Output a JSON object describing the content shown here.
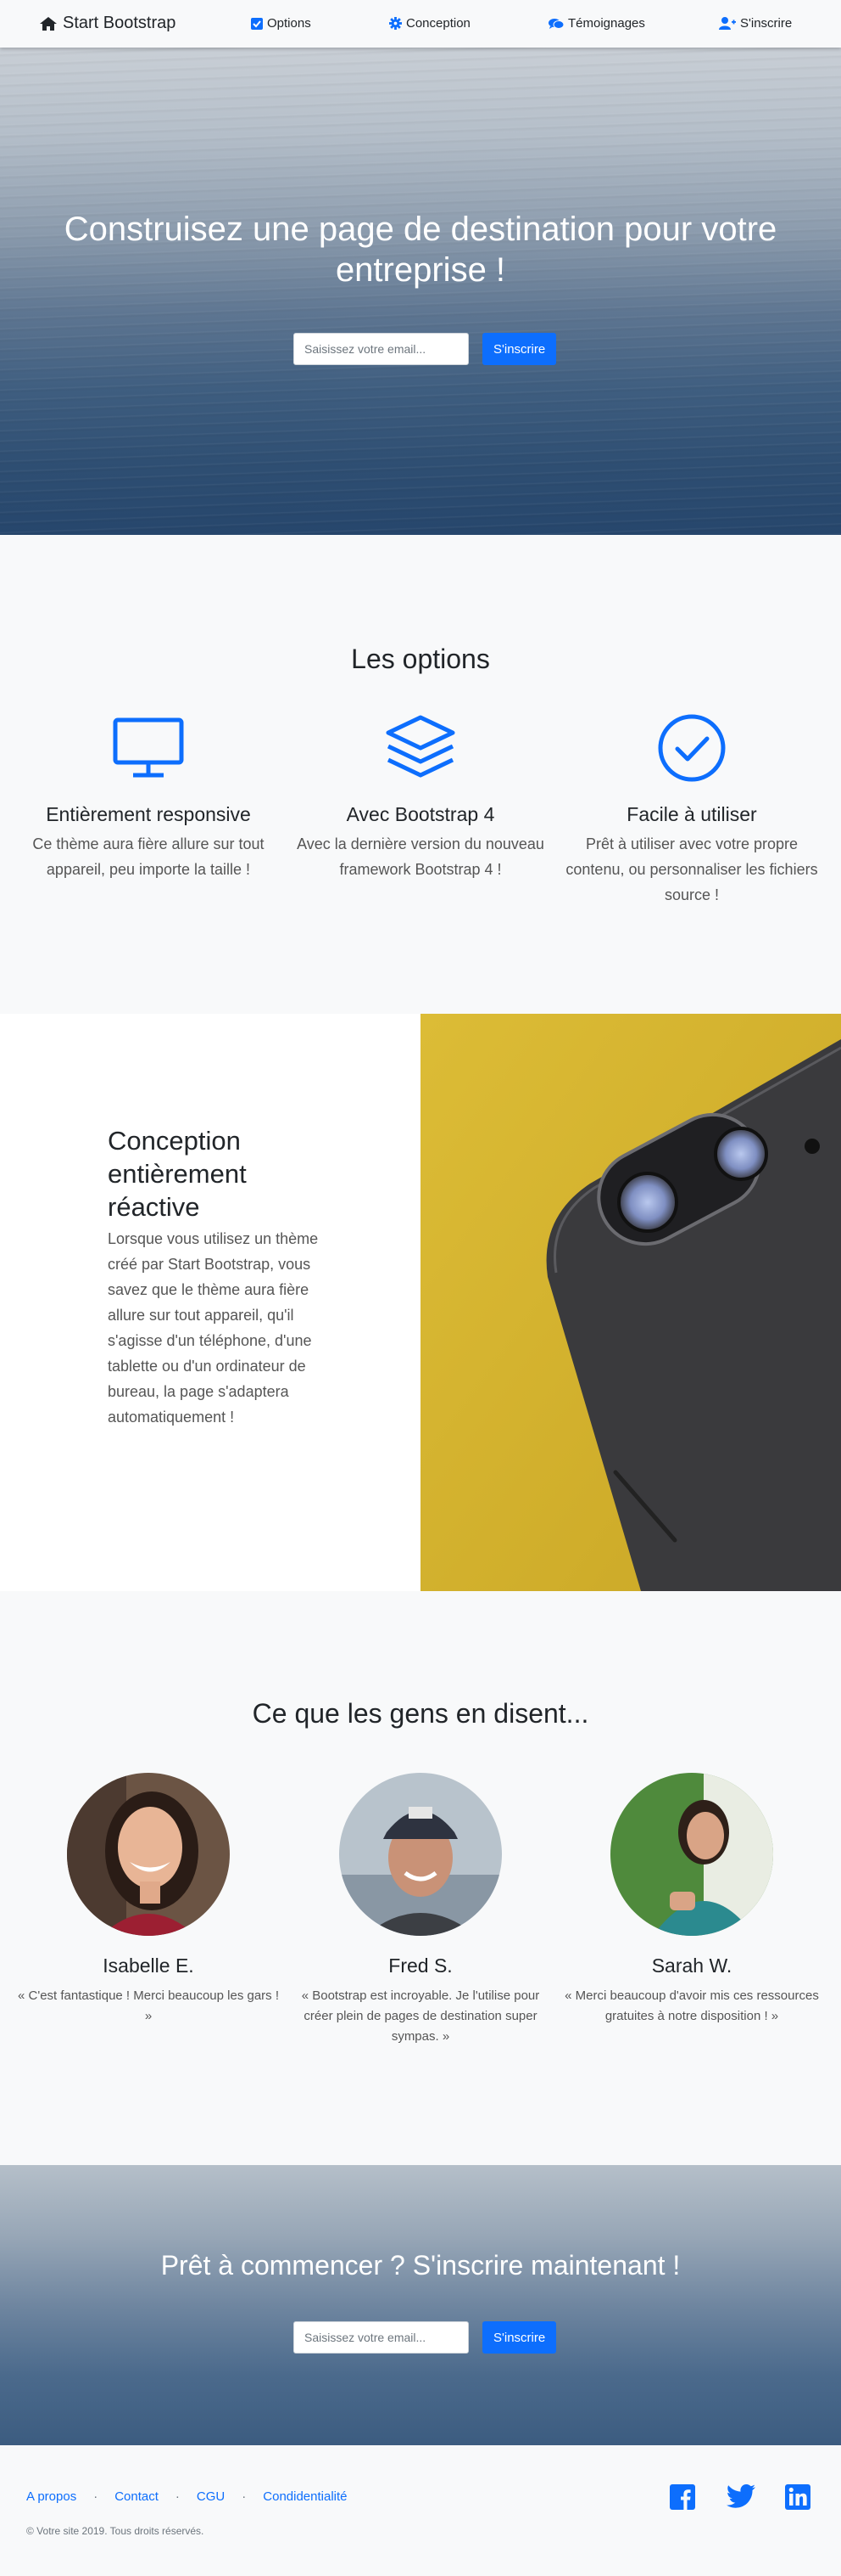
{
  "navbar": {
    "brand": "Start Bootstrap",
    "items": [
      {
        "label": "Options",
        "icon": "check-square-icon"
      },
      {
        "label": "Conception",
        "icon": "gear-icon"
      },
      {
        "label": "Témoignages",
        "icon": "comments-icon"
      },
      {
        "label": "S'inscrire",
        "icon": "user-plus-icon"
      }
    ]
  },
  "hero": {
    "title": "Construisez une page de destination pour votre entreprise !",
    "email_placeholder": "Saisissez votre email...",
    "button": "S'inscrire"
  },
  "options": {
    "title": "Les options",
    "features": [
      {
        "icon": "monitor-icon",
        "title": "Entièrement responsive",
        "text": "Ce thème aura fière allure sur tout appareil, peu importe la taille !"
      },
      {
        "icon": "layers-icon",
        "title": "Avec Bootstrap 4",
        "text": "Avec la dernière version du nouveau framework Bootstrap 4 !"
      },
      {
        "icon": "check-circle-icon",
        "title": "Facile à utiliser",
        "text": "Prêt à utiliser avec votre propre contenu, ou personnaliser les fichiers source !"
      }
    ]
  },
  "showcase": {
    "title": "Conception entièrement réactive",
    "text": "Lorsque vous utilisez un thème créé par Start Bootstrap, vous savez que le thème aura fière allure sur tout appareil, qu'il s'agisse d'un téléphone, d'une tablette ou d'un ordinateur de bureau, la page s'adaptera automatiquement !"
  },
  "testimonials": {
    "title": "Ce que les gens en disent...",
    "people": [
      {
        "name": "Isabelle E.",
        "quote": "« C'est fantastique ! Merci beaucoup les gars ! »"
      },
      {
        "name": "Fred S.",
        "quote": "« Bootstrap est incroyable. Je l'utilise pour créer plein de pages de destination super sympas. »"
      },
      {
        "name": "Sarah W.",
        "quote": "« Merci beaucoup d'avoir mis ces ressources gratuites à notre disposition ! »"
      }
    ]
  },
  "cta": {
    "title": "Prêt à commencer ? S'inscrire maintenant !",
    "email_placeholder": "Saisissez votre email...",
    "button": "S'inscrire"
  },
  "footer": {
    "links": [
      "A propos",
      "Contact",
      "CGU",
      "Condidentialité"
    ],
    "separator": "·",
    "copyright": "© Votre site 2019. Tous droits réservés.",
    "social": [
      "facebook-icon",
      "twitter-icon",
      "linkedin-icon"
    ]
  },
  "colors": {
    "accent": "#0d6efd",
    "text": "#212529",
    "muted": "#555555",
    "background": "#f8f9fa"
  }
}
